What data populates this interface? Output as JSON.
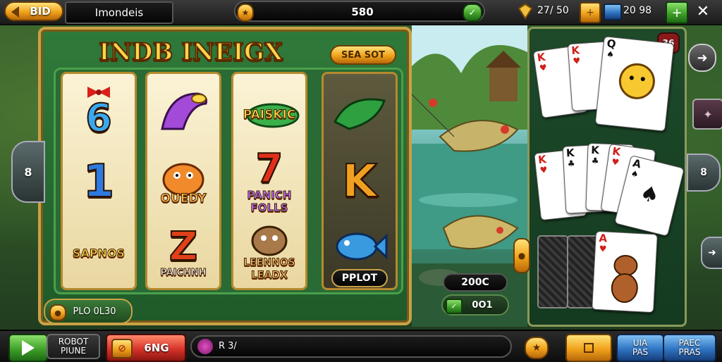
{
  "top": {
    "back_label": "BID",
    "title": "Imondeis",
    "balance": "580",
    "gems": "27/ 50",
    "flags": "20 98"
  },
  "slot": {
    "title": "INDB INEIGX",
    "corner_button": "SEA SOT",
    "reels": [
      {
        "symbols": [
          "6",
          "1",
          "SAPNOS"
        ]
      },
      {
        "symbols": [
          "",
          "OUEDY",
          "PAICHNH"
        ]
      },
      {
        "symbols": [
          "PAISKIC",
          "PANICH FOLLS",
          "LEENNOS LEADX"
        ]
      },
      {
        "symbols": [
          "",
          "K",
          "PPLOT"
        ]
      }
    ],
    "bottom_left_button": "PLO 0L30"
  },
  "river": {
    "bet_display": "200C",
    "bet_button": "0O1"
  },
  "cards": {
    "badge": "36",
    "row1": [
      {
        "rank": "K",
        "suit": "♥"
      },
      {
        "rank": "K",
        "suit": "♥"
      },
      {
        "rank": "Q",
        "suit": "♠"
      }
    ],
    "row2": [
      {
        "rank": "K",
        "suit": "♥"
      },
      {
        "rank": "K",
        "suit": "♣"
      },
      {
        "rank": "K",
        "suit": "♣"
      },
      {
        "rank": "K",
        "suit": "♥"
      },
      {
        "rank": "A",
        "suit": "♠"
      }
    ],
    "row3": [
      {
        "rank": "A",
        "suit": "♥"
      }
    ]
  },
  "side": {
    "left_arrow": "8",
    "right_mid": "8"
  },
  "bottom": {
    "play_label": "ROBOT\nPIUNE",
    "spin_label": "6NG",
    "chat_text": "R 3/",
    "auto_label": "UIA\nPAS",
    "page_label": "PAEC\nPRAS"
  },
  "colors": {
    "gold": "#f0a21a",
    "felt": "#1e4a2a",
    "frame": "#c9a246"
  }
}
